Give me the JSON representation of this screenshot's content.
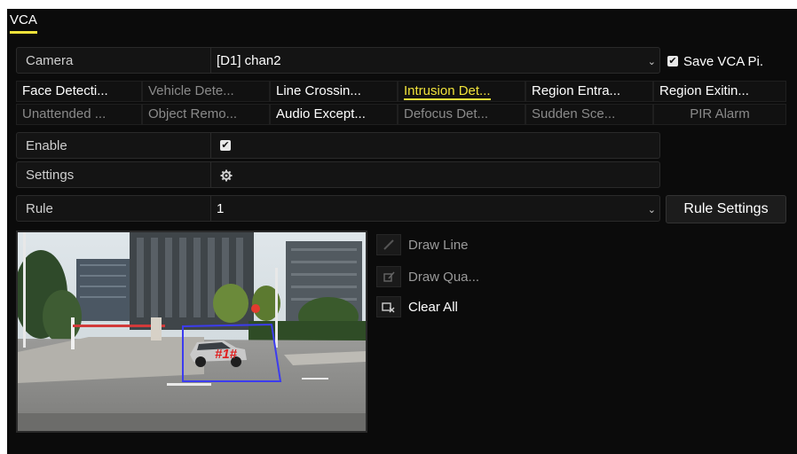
{
  "window": {
    "title": "VCA"
  },
  "camera": {
    "label": "Camera",
    "value": "[D1] chan2"
  },
  "save_pic": {
    "label": "Save VCA Pi.",
    "checked": true
  },
  "tabs": [
    {
      "label": "Face Detecti...",
      "state": "enabled"
    },
    {
      "label": "Vehicle Dete...",
      "state": "disabled"
    },
    {
      "label": "Line Crossin...",
      "state": "enabled"
    },
    {
      "label": "Intrusion Det...",
      "state": "active"
    },
    {
      "label": "Region Entra...",
      "state": "enabled"
    },
    {
      "label": "Region Exitin...",
      "state": "enabled"
    },
    {
      "label": "Unattended ...",
      "state": "disabled"
    },
    {
      "label": "Object Remo...",
      "state": "disabled"
    },
    {
      "label": "Audio Except...",
      "state": "enabled"
    },
    {
      "label": "Defocus Det...",
      "state": "disabled"
    },
    {
      "label": "Sudden Sce...",
      "state": "disabled"
    },
    {
      "label": "PIR Alarm",
      "state": "disabled"
    }
  ],
  "enable": {
    "label": "Enable",
    "checked": true
  },
  "settings": {
    "label": "Settings",
    "icon": "gear-icon"
  },
  "rule": {
    "label": "Rule",
    "value": "1"
  },
  "rule_settings_button": "Rule Settings",
  "tools": [
    {
      "label": "Draw Line",
      "icon": "pencil-icon",
      "enabled": false
    },
    {
      "label": "Draw Qua...",
      "icon": "draw-quadrilateral-icon",
      "enabled": false
    },
    {
      "label": "Clear All",
      "icon": "clear-all-icon",
      "enabled": true
    }
  ],
  "video": {
    "region_label": "#1#",
    "region_color": "#3c3cf0"
  },
  "colors": {
    "accent": "#f0e23a",
    "background": "#0b0b0b",
    "disabled_text": "#8a8a8a",
    "region_label": "#e02020"
  }
}
